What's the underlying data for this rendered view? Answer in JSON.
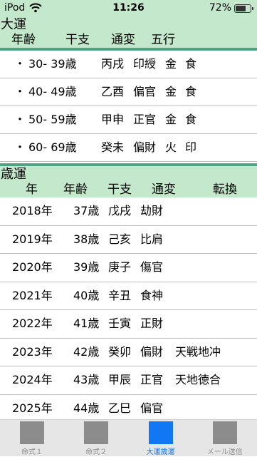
{
  "status_bar": {
    "carrier": "iPod",
    "time": "11:26",
    "battery": "72%",
    "battery_level": 0.72
  },
  "daiun": {
    "title": "大運",
    "headers": {
      "age": "年齢",
      "kanshi": "干支",
      "tsuhen": "通変",
      "gogyo": "五行"
    },
    "rows": [
      {
        "bullet": "・",
        "age": "30- 39歳",
        "kanshi": "丙戌",
        "tsuhen": "印綬",
        "g1": "金",
        "g2": "食"
      },
      {
        "bullet": "・",
        "age": "40- 49歳",
        "kanshi": "乙酉",
        "tsuhen": "偏官",
        "g1": "金",
        "g2": "食"
      },
      {
        "bullet": "・",
        "age": "50- 59歳",
        "kanshi": "甲申",
        "tsuhen": "正官",
        "g1": "金",
        "g2": "食"
      },
      {
        "bullet": "・",
        "age": "60- 69歳",
        "kanshi": "癸未",
        "tsuhen": "偏財",
        "g1": "火",
        "g2": "印"
      }
    ]
  },
  "saiun": {
    "title": "歳運",
    "headers": {
      "year": "年",
      "age": "年齢",
      "kanshi": "干支",
      "tsuhen": "通変",
      "tenkan": "転換"
    },
    "rows": [
      {
        "year": "2018年",
        "age": "37歳",
        "kanshi": "戊戌",
        "tsuhen": "劫財",
        "tenkan": ""
      },
      {
        "year": "2019年",
        "age": "38歳",
        "kanshi": "己亥",
        "tsuhen": "比肩",
        "tenkan": ""
      },
      {
        "year": "2020年",
        "age": "39歳",
        "kanshi": "庚子",
        "tsuhen": "傷官",
        "tenkan": ""
      },
      {
        "year": "2021年",
        "age": "40歳",
        "kanshi": "辛丑",
        "tsuhen": "食神",
        "tenkan": ""
      },
      {
        "year": "2022年",
        "age": "41歳",
        "kanshi": "壬寅",
        "tsuhen": "正財",
        "tenkan": ""
      },
      {
        "year": "2023年",
        "age": "42歳",
        "kanshi": "癸卯",
        "tsuhen": "偏財",
        "tenkan": "天戦地冲"
      },
      {
        "year": "2024年",
        "age": "43歳",
        "kanshi": "甲辰",
        "tsuhen": "正官",
        "tenkan": "天地徳合"
      },
      {
        "year": "2025年",
        "age": "44歳",
        "kanshi": "乙巳",
        "tsuhen": "偏官",
        "tenkan": ""
      }
    ]
  },
  "tabs": [
    {
      "label": "命式１",
      "active": false
    },
    {
      "label": "命式２",
      "active": false
    },
    {
      "label": "大運歳運",
      "active": true
    },
    {
      "label": "メール送信",
      "active": false
    }
  ],
  "colors": {
    "header_bg": "#c4e8cb",
    "rule": "#4fa385",
    "tab_active": "#1177f2",
    "tab_inactive": "#8c8c8c",
    "tab_bar_bg": "#e6e6e6"
  }
}
